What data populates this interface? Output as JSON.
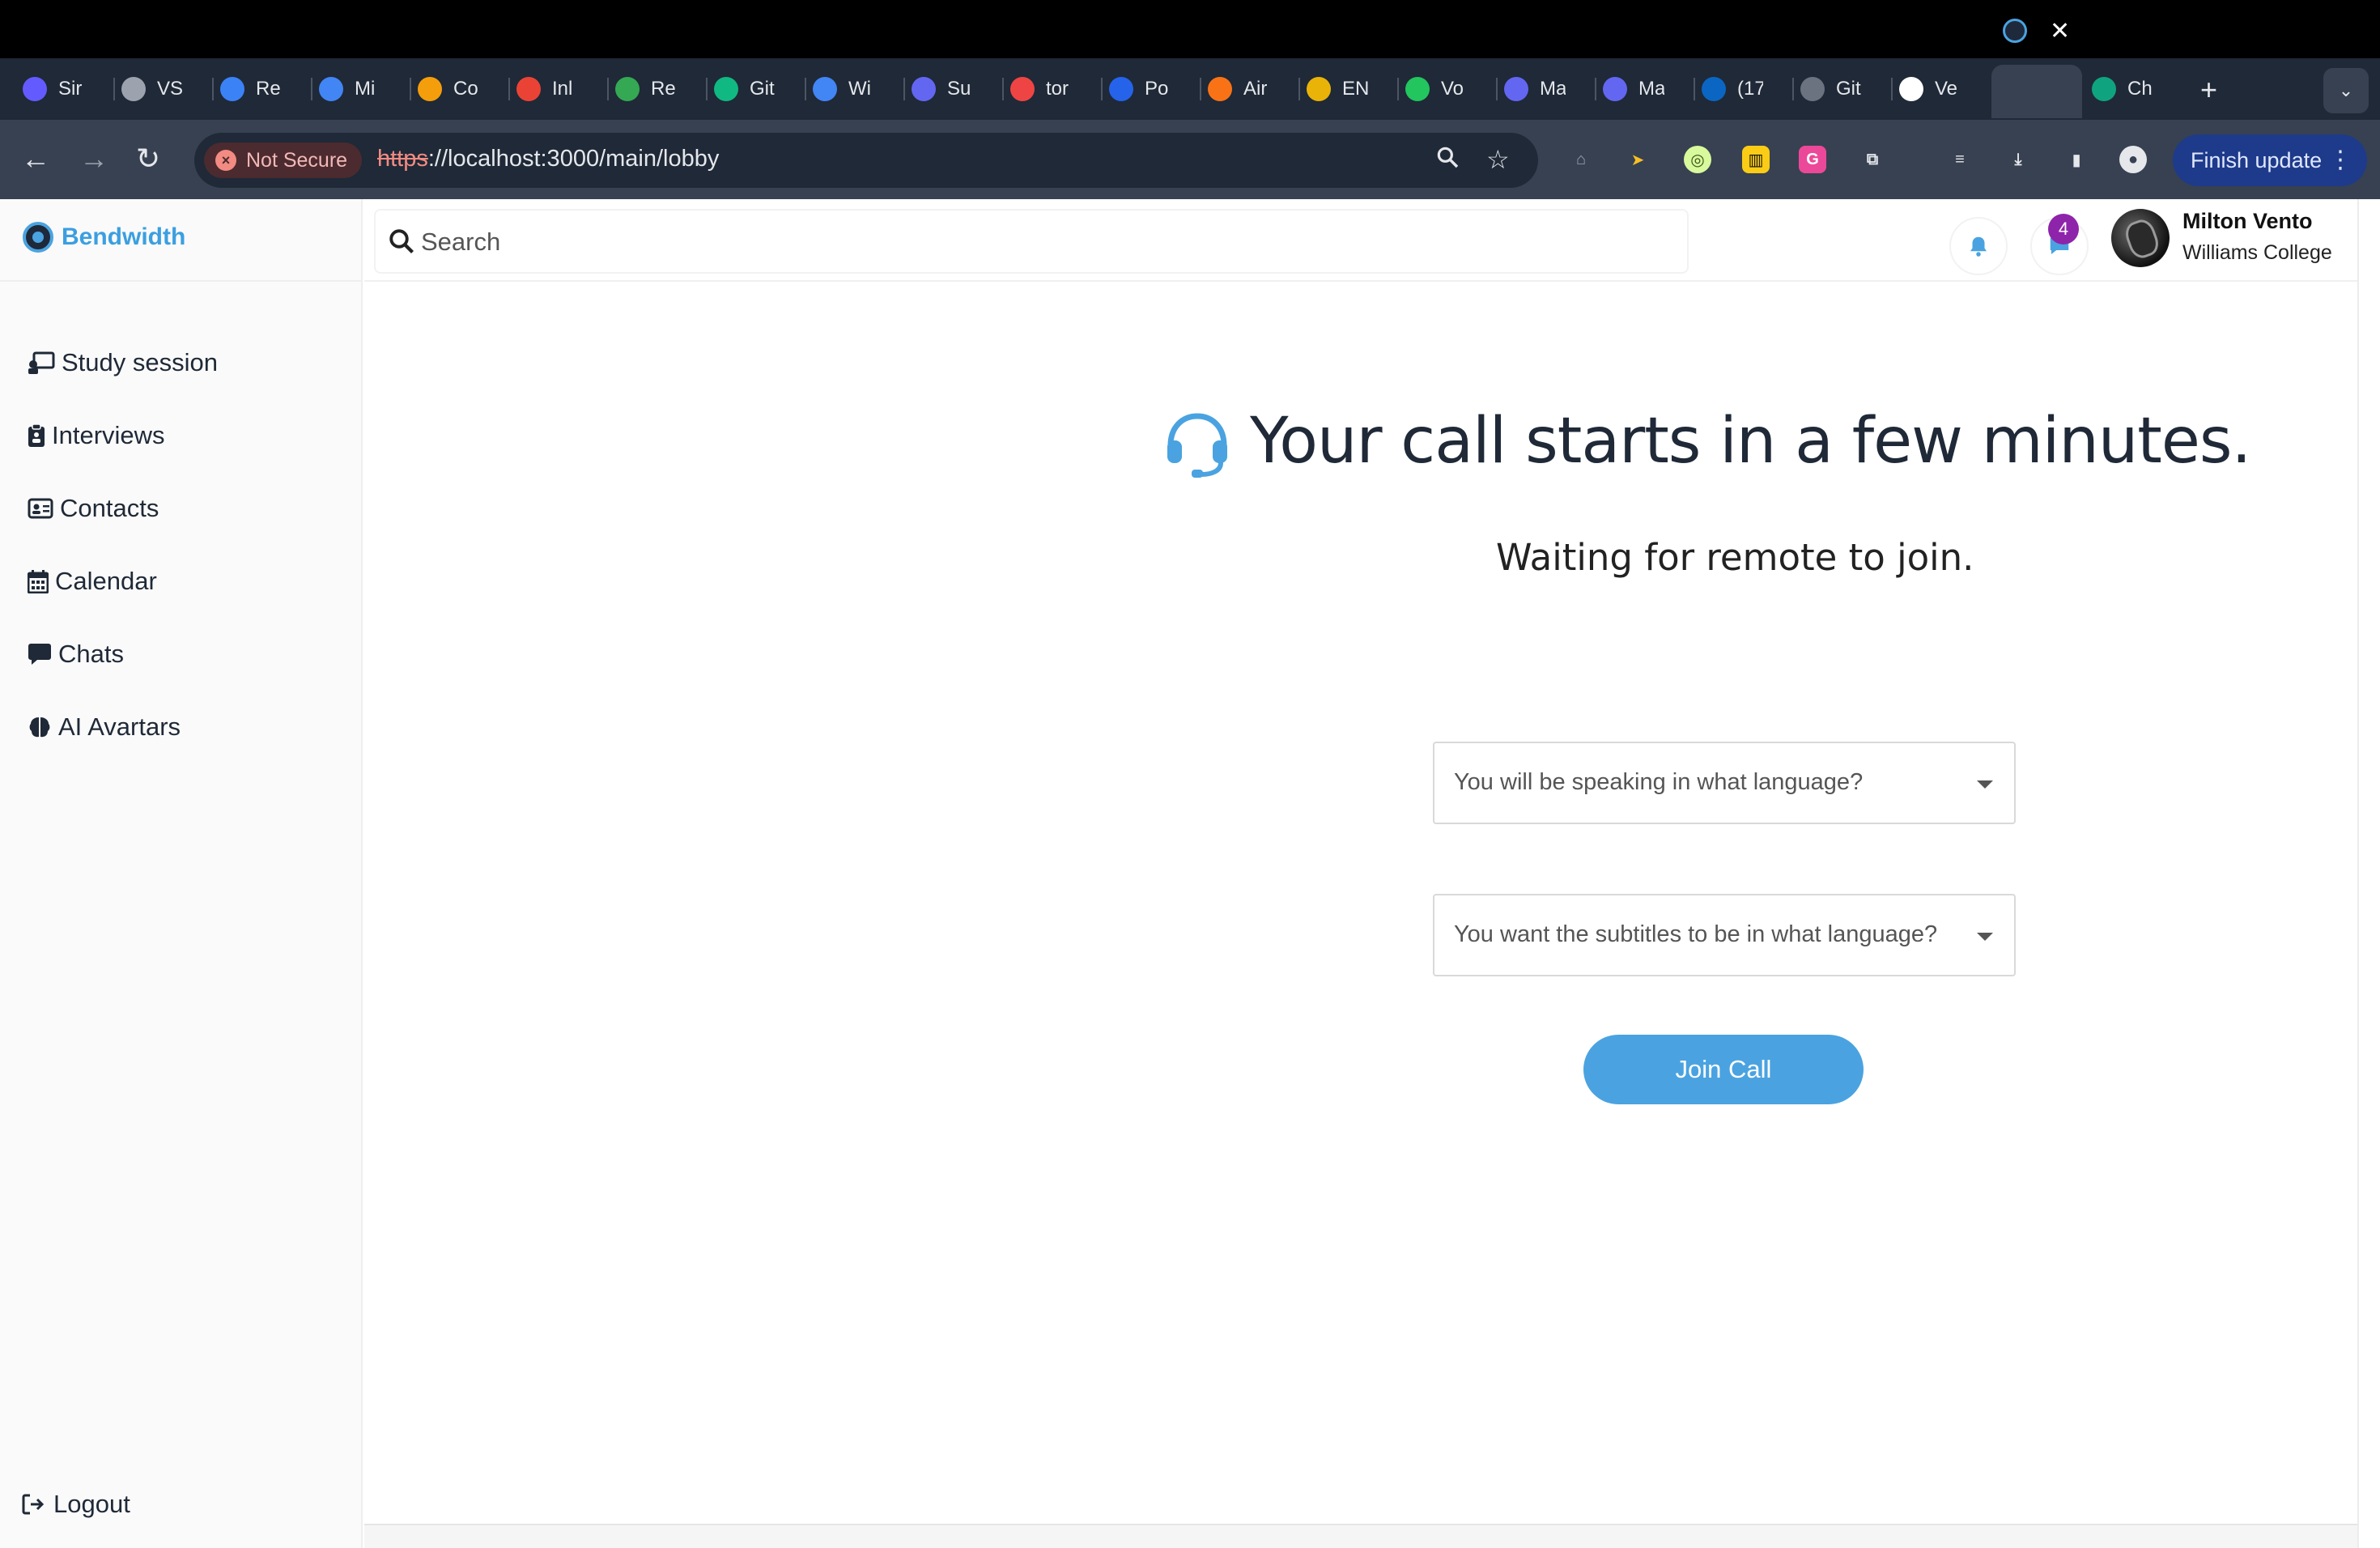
{
  "browser": {
    "tabs": [
      {
        "label": "Sir",
        "icon": "stripe-s-icon",
        "color": "#635bff"
      },
      {
        "label": "VS",
        "icon": "vs-icon",
        "color": "#9ca3af"
      },
      {
        "label": "Re",
        "icon": "chrome-web-icon",
        "color": "#3b82f6"
      },
      {
        "label": "Mi",
        "icon": "docs-icon",
        "color": "#4285f4"
      },
      {
        "label": "Co",
        "icon": "coin-icon",
        "color": "#f59e0b"
      },
      {
        "label": "Inl",
        "icon": "gmail-icon",
        "color": "#ea4335"
      },
      {
        "label": "Re",
        "icon": "drive-icon",
        "color": "#34a853"
      },
      {
        "label": "Git",
        "icon": "github-copilot-icon",
        "color": "#10b981"
      },
      {
        "label": "Wi",
        "icon": "calendar-icon",
        "color": "#4285f4"
      },
      {
        "label": "Su",
        "icon": "lines-icon",
        "color": "#6366f1"
      },
      {
        "label": "tor",
        "icon": "target-icon",
        "color": "#ef4444"
      },
      {
        "label": "Po",
        "icon": "zoom-icon",
        "color": "#2563eb"
      },
      {
        "label": "Air",
        "icon": "chrome-web-icon",
        "color": "#f97316"
      },
      {
        "label": "EN",
        "icon": "chrome-web-icon",
        "color": "#eab308"
      },
      {
        "label": "Vo",
        "icon": "chrome-web-icon",
        "color": "#22c55e"
      },
      {
        "label": "Ma",
        "icon": "lines-icon",
        "color": "#6366f1"
      },
      {
        "label": "Ma",
        "icon": "lines-icon",
        "color": "#6366f1"
      },
      {
        "label": "(17",
        "icon": "linkedin-icon",
        "color": "#0a66c2"
      },
      {
        "label": "Git",
        "icon": "loading-icon",
        "color": "#6b7280"
      },
      {
        "label": "Ve",
        "icon": "github-icon",
        "color": "#ffffff"
      },
      {
        "label": "Ch",
        "icon": "chatgpt-icon",
        "color": "#10a37f"
      }
    ],
    "not_secure": "Not Secure",
    "url_scheme": "https",
    "url_rest": "://localhost:3000/main/lobby",
    "finish_update": "Finish update"
  },
  "sidebar": {
    "brand": "Bendwidth",
    "items": [
      {
        "label": "Study session",
        "icon": "study-session-icon"
      },
      {
        "label": "Interviews",
        "icon": "clipboard-icon"
      },
      {
        "label": "Contacts",
        "icon": "contact-card-icon"
      },
      {
        "label": "Calendar",
        "icon": "calendar-icon"
      },
      {
        "label": "Chats",
        "icon": "chat-bubble-icon"
      },
      {
        "label": "AI Avartars",
        "icon": "brain-icon"
      }
    ],
    "logout": "Logout"
  },
  "header": {
    "search_placeholder": "Search",
    "message_count": "4",
    "user_name": "Milton Vento",
    "user_org": "Williams College"
  },
  "main": {
    "title": "Your call starts in a few minutes.",
    "subtitle": "Waiting for remote to join.",
    "speak_language_placeholder": "You will be speaking in what language?",
    "subtitle_language_placeholder": "You want the subtitles to be in what language?",
    "join_button": "Join Call"
  },
  "colors": {
    "accent": "#4aa3e0",
    "badge": "#8e24aa",
    "browser_tabstrip": "#1f2937",
    "browser_toolbar": "#374151"
  }
}
